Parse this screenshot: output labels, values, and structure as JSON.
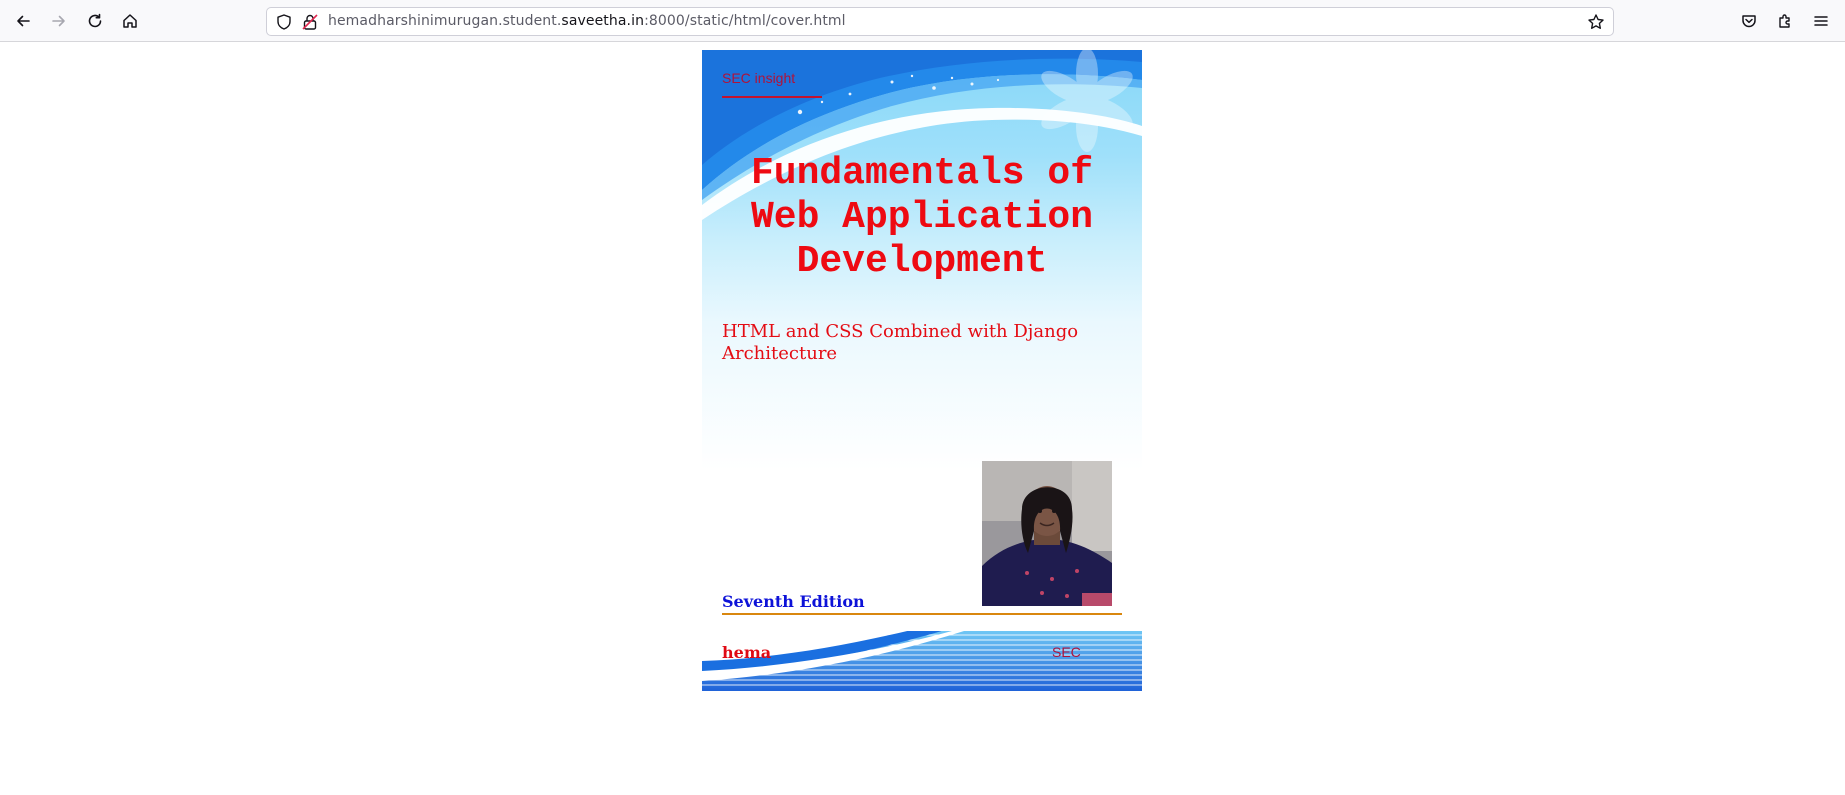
{
  "browser": {
    "url_prefix": "hemadharshinimurugan.student.",
    "url_domain": "saveetha.in",
    "url_suffix": ":8000/static/html/cover.html"
  },
  "cover": {
    "brand": "SEC insight",
    "title": "Fundamentals of Web Application Development",
    "subtitle": "HTML and CSS Combined with Django Architecture",
    "edition": "Seventh Edition",
    "author": "hema",
    "organization": "SEC"
  },
  "colors": {
    "title": "#ee0a12",
    "edition": "#0d12d8",
    "rule": "#d9870f",
    "banner_blue": "#1a6fe0"
  },
  "icons": [
    "back-arrow-icon",
    "forward-arrow-icon",
    "reload-icon",
    "home-icon",
    "shield-icon",
    "insecure-lock-icon",
    "bookmark-star-icon",
    "pocket-icon",
    "extensions-icon",
    "menu-icon"
  ]
}
